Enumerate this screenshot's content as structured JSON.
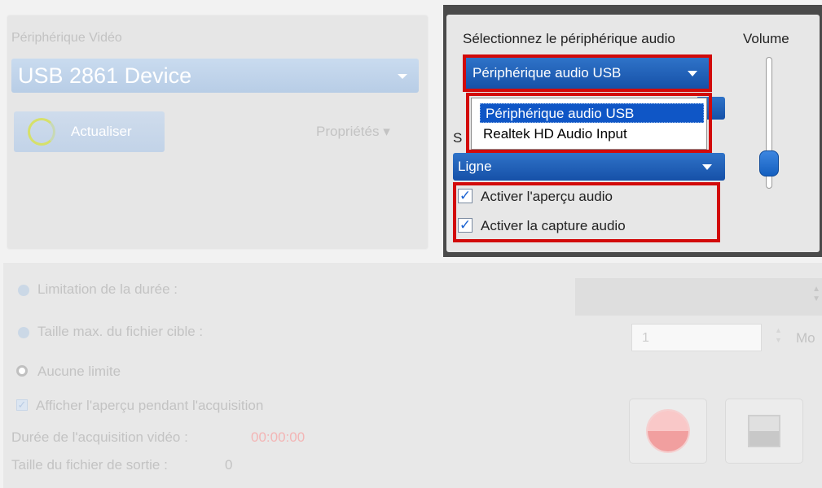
{
  "video": {
    "section_label": "Périphérique Vidéo",
    "device_value": "USB 2861 Device",
    "refresh_label": "Actualiser",
    "properties_label": "Propriétés ▾"
  },
  "audio": {
    "select_label": "Sélectionnez le périphérique audio",
    "volume_label": "Volume",
    "device_value": "Périphérique audio USB",
    "device_options": [
      "Périphérique audio USB",
      "Realtek HD Audio Input"
    ],
    "source_label_partial": "S",
    "source_value": "Ligne",
    "preview_label": "Activer l'aperçu audio",
    "preview_checked": true,
    "capture_label": "Activer la capture audio",
    "capture_checked": true,
    "volume_level_fraction": 0.2
  },
  "capture": {
    "limit_duration_label": "Limitation de la durée :",
    "max_size_label": "Taille max. du fichier cible :",
    "max_size_value": "1",
    "max_size_unit": "Mo",
    "no_limit_label": "Aucune limite",
    "show_preview_label": "Afficher l'aperçu pendant l'acquisition",
    "duration_label": "Durée de l'acquisition vidéo :",
    "duration_value": "00:00:00",
    "output_size_label": "Taille du fichier de sortie :",
    "output_size_value": "0"
  },
  "colors": {
    "highlight_red": "#d20a0a",
    "accent_blue": "#1651a8",
    "selection_blue": "#0f56c6"
  }
}
